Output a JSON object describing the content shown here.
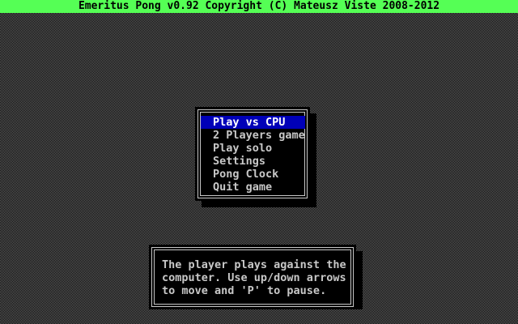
{
  "window": {
    "title": "Emeritus Pong v0.92 Copyright (C) Mateusz Viste 2008-2012"
  },
  "menu": {
    "items": [
      {
        "label": "Play vs CPU",
        "selected": true
      },
      {
        "label": "2 Players game",
        "selected": false
      },
      {
        "label": "Play solo",
        "selected": false
      },
      {
        "label": "Settings",
        "selected": false
      },
      {
        "label": "Pong Clock",
        "selected": false
      },
      {
        "label": "Quit game",
        "selected": false
      }
    ]
  },
  "description": {
    "lines": [
      "The player plays against the",
      "computer. Use up/down arrows",
      "to move and 'P' to pause."
    ]
  },
  "colors": {
    "title_bar_bg": "#55ff55",
    "selection_bg": "#0000b8",
    "text": "#c8c8c8",
    "selected_text": "#ffffff",
    "backdrop_dither": "#6a6a6a"
  }
}
